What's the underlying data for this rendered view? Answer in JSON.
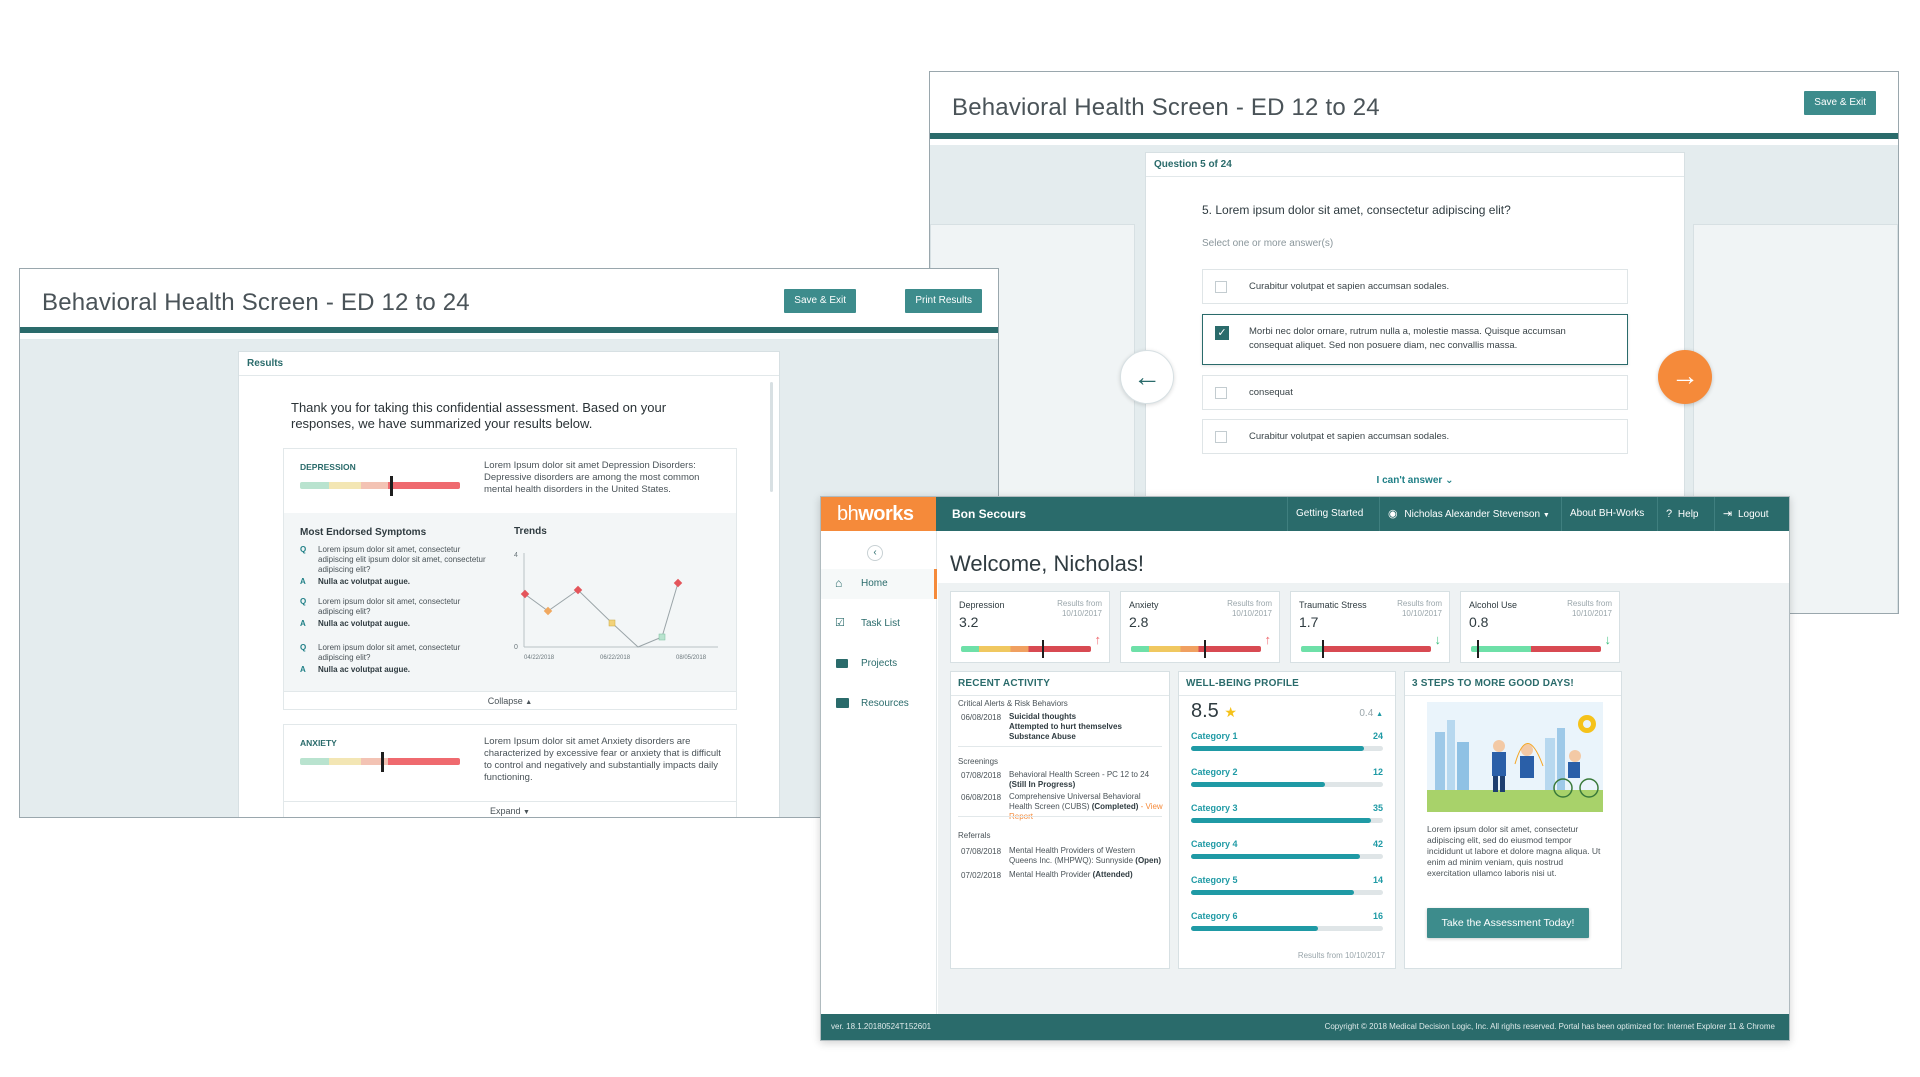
{
  "results_window": {
    "title": "Behavioral Health Screen - ED 12 to 24",
    "save_exit": "Save & Exit",
    "print_results": "Print Results",
    "tag": "Results",
    "intro": "Thank you for taking this confidential assessment. Based on your responses, we have summarized your results below.",
    "depression": {
      "label": "DEPRESSION",
      "level": 0.57,
      "text": "Lorem Ipsum dolor sit amet Depression Disorders: Depressive disorders are among the most common mental health disorders in the United States."
    },
    "symptoms_title": "Most Endorsed Symptoms",
    "trends_title": "Trends",
    "qa": [
      {
        "q_mark": "Q",
        "q": "Lorem ipsum dolor sit amet, consectetur adipiscing elit ipsum dolor sit amet, consectetur adipiscing elit?",
        "a_mark": "A",
        "a": "Nulla ac volutpat augue."
      },
      {
        "q_mark": "Q",
        "q": "Lorem ipsum dolor sit amet, consectetur adipiscing elit?",
        "a_mark": "A",
        "a": "Nulla ac volutpat augue."
      },
      {
        "q_mark": "Q",
        "q": "Lorem ipsum dolor sit amet, consectetur adipiscing elit?",
        "a_mark": "A",
        "a": "Nulla ac volutpat augue."
      }
    ],
    "trend_chart": {
      "y_top": "4",
      "y_bottom": "0",
      "x_labels": [
        "04/22/2018",
        "06/22/2018",
        "08/05/2018"
      ]
    },
    "collapse": "Collapse",
    "anxiety": {
      "label": "ANXIETY",
      "level": 0.51,
      "text": "Lorem Ipsum dolor sit amet Anxiety disorders are characterized by excessive fear or anxiety that is difficult to control and negatively and substantially impacts daily functioning."
    },
    "expand": "Expand"
  },
  "question_window": {
    "title": "Behavioral Health Screen - ED 12 to 24",
    "save_exit": "Save & Exit",
    "tag": "Question 5 of 24",
    "question": "5. Lorem ipsum dolor sit amet, consectetur adipiscing elit?",
    "instruction": "Select one or more answer(s)",
    "options": [
      {
        "text": "Curabitur volutpat et sapien accumsan sodales.",
        "checked": false
      },
      {
        "text": "Morbi nec dolor ornare, rutrum nulla a, molestie massa. Quisque accumsan consequat aliquet. Sed non posuere diam, nec convallis massa.",
        "checked": true
      },
      {
        "text": "consequat",
        "checked": false
      },
      {
        "text": "Curabitur volutpat et sapien accumsan sodales.",
        "checked": false
      }
    ],
    "cant_answer": "I can't answer"
  },
  "portal_window": {
    "logo_a": "bh",
    "logo_b": "works",
    "org": "Bon Secours",
    "nav": {
      "getting_started": "Getting Started",
      "user": "Nicholas Alexander Stevenson",
      "about": "About BH-Works",
      "help": "Help",
      "logout": "Logout"
    },
    "sidebar": [
      {
        "label": "Home",
        "icon": "home-icon",
        "active": true
      },
      {
        "label": "Task List",
        "icon": "task-list-icon",
        "active": false
      },
      {
        "label": "Projects",
        "icon": "folder-icon",
        "active": false
      },
      {
        "label": "Resources",
        "icon": "briefcase-icon",
        "active": false
      }
    ],
    "welcome": "Welcome, Nicholas!",
    "scores": [
      {
        "name": "Depression",
        "value": "3.2",
        "from": "Results from",
        "date": "10/10/2017",
        "trend": "up",
        "level": 0.63
      },
      {
        "name": "Anxiety",
        "value": "2.8",
        "from": "Results from",
        "date": "10/10/2017",
        "trend": "up",
        "level": 0.57
      },
      {
        "name": "Traumatic Stress",
        "value": "1.7",
        "from": "Results from",
        "date": "10/10/2017",
        "trend": "down",
        "level": 0.17
      },
      {
        "name": "Alcohol Use",
        "value": "0.8",
        "from": "Results from",
        "date": "10/10/2017",
        "trend": "down",
        "level": 0.05
      }
    ],
    "recent_activity": {
      "title": "RECENT ACTIVITY",
      "critical_title": "Critical Alerts & Risk Behaviors",
      "critical_date": "06/08/2018",
      "critical_items": [
        "Suicidal thoughts",
        "Attempted to hurt themselves",
        "Substance Abuse"
      ],
      "screenings_title": "Screenings",
      "screenings": [
        {
          "date": "07/08/2018",
          "text": "Behavioral Health Screen - PC 12 to 24",
          "status": "(Still In Progress)",
          "link": ""
        },
        {
          "date": "06/08/2018",
          "text": "Comprehensive Universal Behavioral Health Screen (CUBS)",
          "status": "(Completed)",
          "link": "- View Report"
        }
      ],
      "referrals_title": "Referrals",
      "referrals": [
        {
          "date": "07/08/2018",
          "text": "Mental Health Providers of Western Queens Inc. (MHPWQ): Sunnyside",
          "status": "(Open)"
        },
        {
          "date": "07/02/2018",
          "text": "Mental Health Provider",
          "status": "(Attended)"
        }
      ]
    },
    "wellbeing": {
      "title": "WELL-BEING PROFILE",
      "score": "8.5",
      "delta": "0.4",
      "categories": [
        {
          "label": "Category 1",
          "value": "24",
          "fill": 0.9
        },
        {
          "label": "Category 2",
          "value": "12",
          "fill": 0.7
        },
        {
          "label": "Category 3",
          "value": "35",
          "fill": 0.94
        },
        {
          "label": "Category 4",
          "value": "42",
          "fill": 0.88
        },
        {
          "label": "Category 5",
          "value": "14",
          "fill": 0.85
        },
        {
          "label": "Category 6",
          "value": "16",
          "fill": 0.66
        }
      ],
      "footer": "Results from 10/10/2017"
    },
    "steps": {
      "title": "3 STEPS TO MORE GOOD DAYS!",
      "text": "Lorem ipsum dolor sit amet, consectetur adipiscing elit, sed do eiusmod tempor incididunt ut labore et dolore magna aliqua. Ut enim ad minim veniam, quis nostrud exercitation ullamco laboris nisi ut.",
      "button": "Take the Assessment Today!"
    },
    "footer": {
      "version": "ver. 18.1.20180524T152601",
      "copyright": "Copyright © 2018 Medical Decision Logic, Inc. All rights reserved. Portal has been optimized for: Internet Explorer 11 & Chrome"
    },
    "colors": {
      "teal": "#2a6b6b",
      "orange": "#f58a3a",
      "accent": "#1f9aa5"
    }
  }
}
